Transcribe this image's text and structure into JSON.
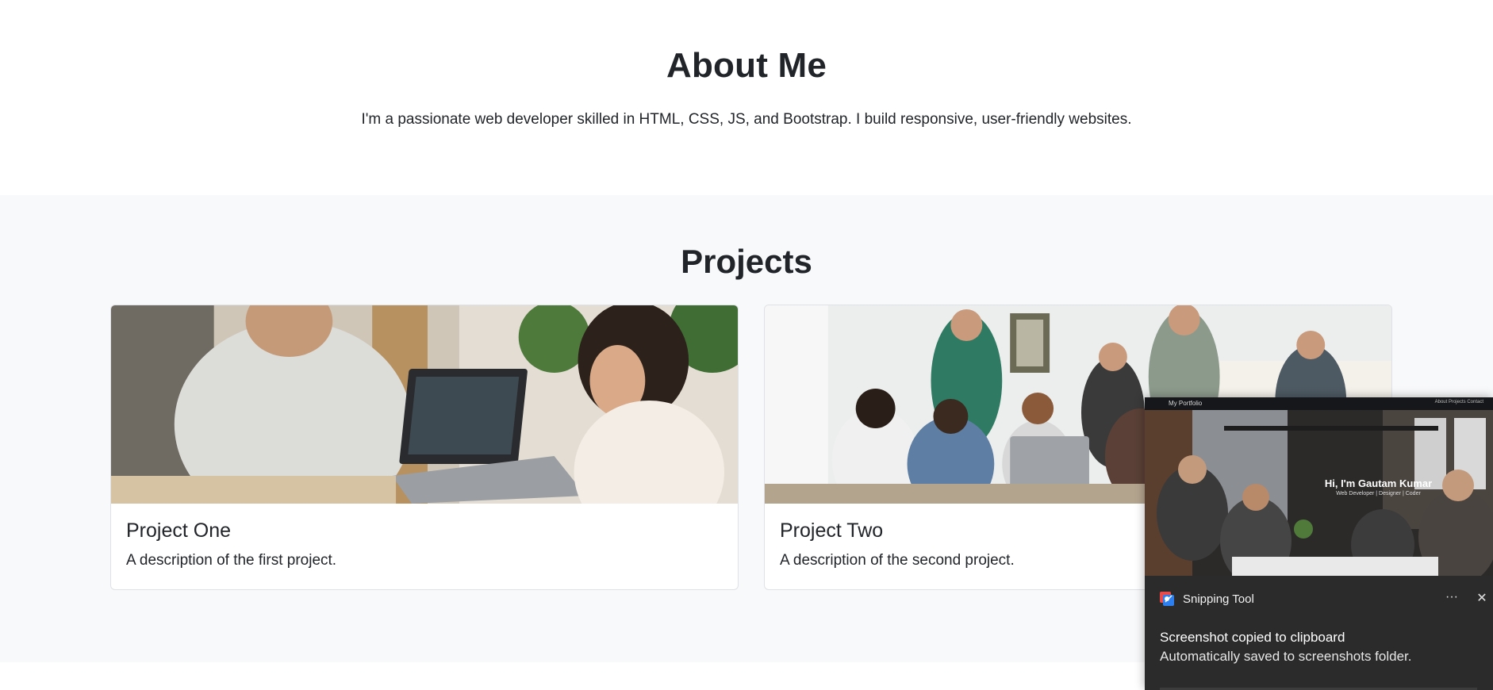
{
  "about": {
    "heading": "About Me",
    "text": "I'm a passionate web developer skilled in HTML, CSS, JS, and Bootstrap. I build responsive, user-friendly websites."
  },
  "projects": {
    "heading": "Projects",
    "cards": [
      {
        "title": "Project One",
        "description": "A description of the first project.",
        "image": "photo-two-people-with-laptop"
      },
      {
        "title": "Project Two",
        "description": "A description of the second project.",
        "image": "photo-team-meeting-table"
      }
    ]
  },
  "toast": {
    "app_name": "Snipping Tool",
    "message_title": "Screenshot copied to clipboard",
    "message_sub": "Automatically saved to screenshots folder.",
    "more_label": "···",
    "close_label": "✕",
    "preview": {
      "brand": "My Portfolio",
      "nav": "About  Projects  Contact",
      "hero_title": "Hi, I'm Gautam Kumar",
      "hero_sub": "Web Developer | Designer | Coder"
    }
  },
  "colors": {
    "text": "#212529",
    "section_alt_bg": "#f8f9fa",
    "card_border": "#dee2e6",
    "toast_bg": "#2b2b2b"
  }
}
